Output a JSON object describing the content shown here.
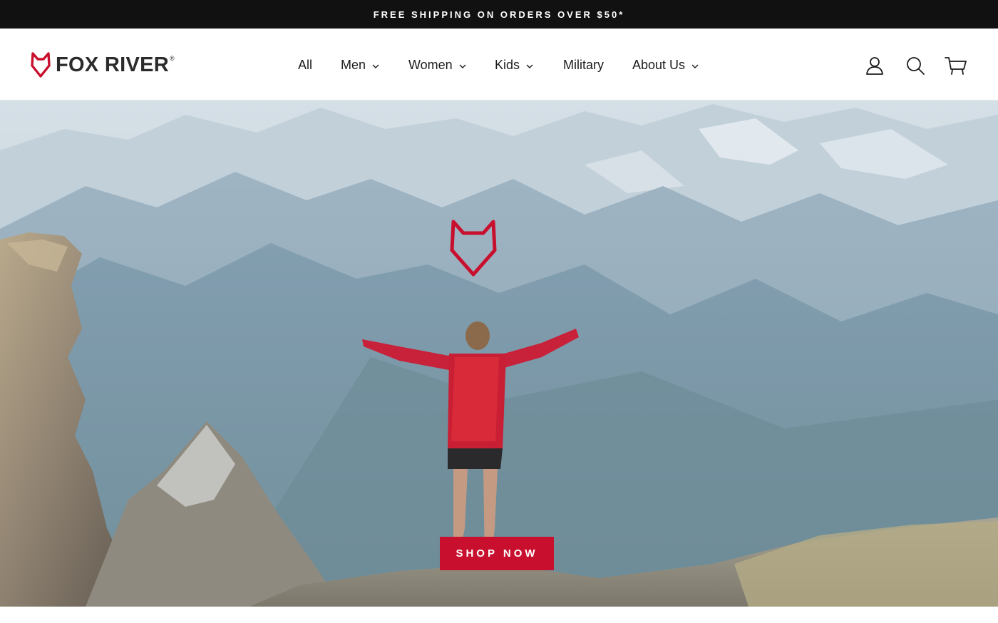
{
  "announcement": {
    "text": "FREE SHIPPING ON ORDERS OVER $50*"
  },
  "brand": {
    "name": "FOX RIVER",
    "registered": "®",
    "accent_color": "#c8102e"
  },
  "nav": {
    "items": [
      {
        "label": "All",
        "has_dropdown": false
      },
      {
        "label": "Men",
        "has_dropdown": true
      },
      {
        "label": "Women",
        "has_dropdown": true
      },
      {
        "label": "Kids",
        "has_dropdown": true
      },
      {
        "label": "Military",
        "has_dropdown": false
      },
      {
        "label": "About Us",
        "has_dropdown": true
      }
    ]
  },
  "header_icons": [
    "account-icon",
    "search-icon",
    "cart-icon"
  ],
  "hero": {
    "cta_label": "SHOP NOW",
    "cta_color": "#c8102e",
    "mark": "fox-head-logo"
  }
}
